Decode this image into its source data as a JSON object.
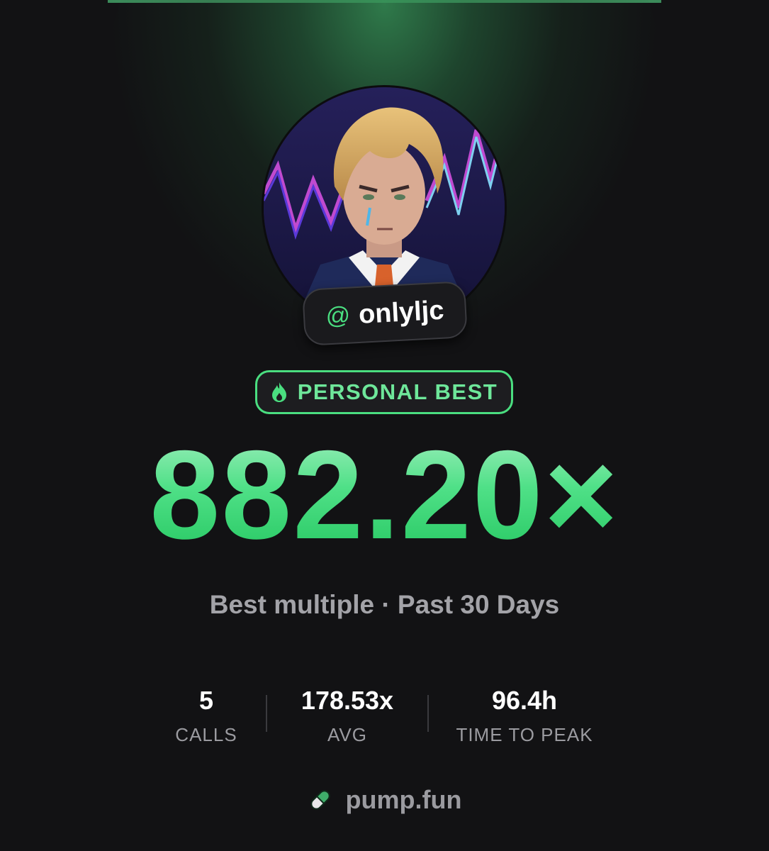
{
  "profile": {
    "handle_prefix": "@",
    "handle": "onlyljc",
    "avatar_icon": "trader-avatar-illustration"
  },
  "badge": {
    "icon": "flame-icon",
    "label": "PERSONAL BEST"
  },
  "highlight": {
    "value": "882.20×",
    "subtitle": "Best multiple · Past 30 Days"
  },
  "stats": [
    {
      "value": "5",
      "label": "CALLS"
    },
    {
      "value": "178.53x",
      "label": "AVG"
    },
    {
      "value": "96.4h",
      "label": "TIME TO PEAK"
    }
  ],
  "footer": {
    "icon": "pill-icon",
    "label": "pump.fun"
  },
  "colors": {
    "background": "#121214",
    "accent": "#4ade80",
    "muted_text": "#a3a3a8"
  }
}
